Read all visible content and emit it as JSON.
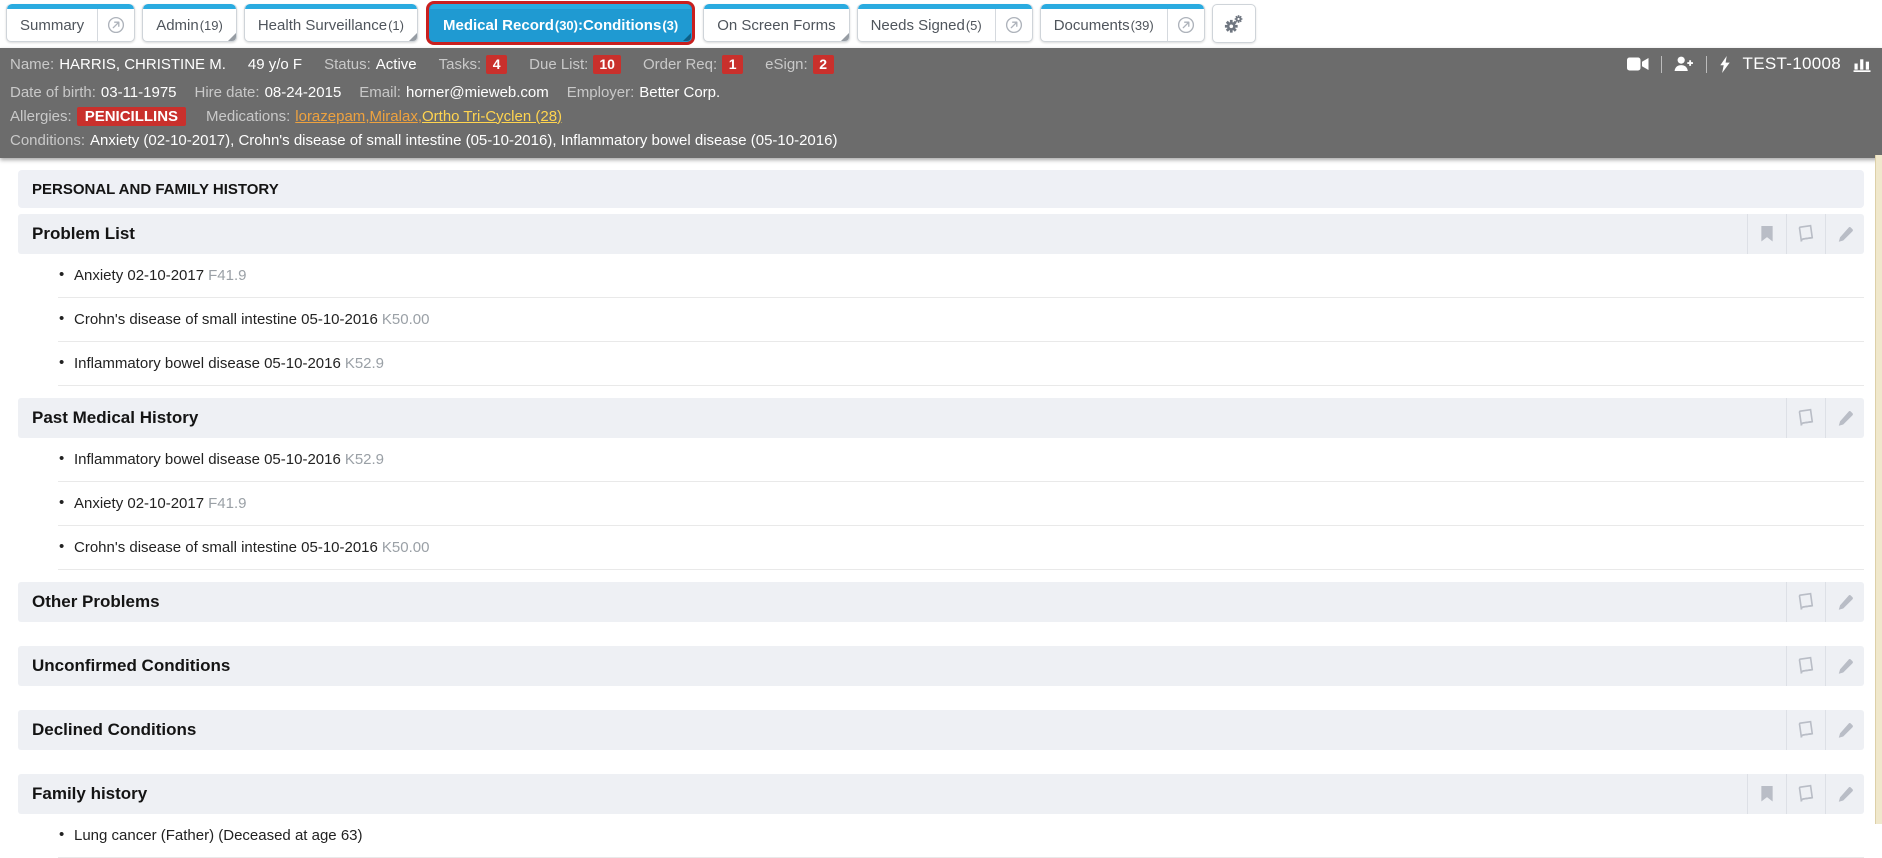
{
  "colors": {
    "tab_blue": "#1f9ad2",
    "tab_cap_blue": "#2aabe0",
    "active_tab_outline_red": "#c9201f",
    "header_bg_gray": "#6c6c6c",
    "badge_red": "#c9302c",
    "band_bg": "#eef0f4",
    "icon_gray": "#b9bdc6",
    "medication_orange": "#eea23f",
    "medication_yellow": "#ffd44f",
    "edge_strip_beige": "#f0e8cc"
  },
  "tab_bar": {
    "tabs": [
      {
        "name": "summary",
        "segments": [
          {
            "text": "Summary",
            "small": false
          }
        ],
        "popout": true,
        "fold": false,
        "active": false
      },
      {
        "name": "admin",
        "segments": [
          {
            "text": "Admin ",
            "small": false
          },
          {
            "text": "(19)",
            "small": true
          }
        ],
        "popout": false,
        "fold": true,
        "active": false
      },
      {
        "name": "health-surveillance",
        "segments": [
          {
            "text": "Health Surveillance ",
            "small": false
          },
          {
            "text": "(1)",
            "small": true
          }
        ],
        "popout": false,
        "fold": true,
        "active": false
      },
      {
        "name": "medical-record",
        "segments": [
          {
            "text": "Medical Record ",
            "small": false
          },
          {
            "text": "(30)",
            "small": true
          },
          {
            "text": ":Conditions ",
            "small": false
          },
          {
            "text": "(3)",
            "small": true
          }
        ],
        "popout": false,
        "fold": true,
        "active": true
      },
      {
        "name": "on-screen-forms",
        "segments": [
          {
            "text": "On Screen Forms",
            "small": false
          }
        ],
        "popout": false,
        "fold": true,
        "active": false
      },
      {
        "name": "needs-signed",
        "segments": [
          {
            "text": "Needs Signed ",
            "small": false
          },
          {
            "text": "(5)",
            "small": true
          }
        ],
        "popout": true,
        "fold": false,
        "active": false
      },
      {
        "name": "documents",
        "segments": [
          {
            "text": "Documents ",
            "small": false
          },
          {
            "text": "(39)",
            "small": true
          }
        ],
        "popout": true,
        "fold": false,
        "active": false
      }
    ]
  },
  "patient_header": {
    "row1": {
      "fields": [
        {
          "label": "Name:",
          "value": "HARRIS, CHRISTINE M."
        },
        {
          "label": "",
          "value": "49 y/o F"
        },
        {
          "label": "Status:",
          "value": "Active"
        },
        {
          "label": "Tasks:",
          "badge": "4"
        },
        {
          "label": "Due List:",
          "badge": "10"
        },
        {
          "label": "Order Req:",
          "badge": "1"
        },
        {
          "label": "eSign:",
          "badge": "2"
        }
      ],
      "station_id": "TEST-10008"
    },
    "row2": {
      "fields": [
        {
          "label": "Date of birth:",
          "value": "03-11-1975"
        },
        {
          "label": "Hire date:",
          "value": "08-24-2015"
        },
        {
          "label": "Email:",
          "value": "horner@mieweb.com"
        },
        {
          "label": "Employer:",
          "value": "Better Corp."
        }
      ]
    },
    "row3": {
      "allergies_label": "Allergies:",
      "allergy_badge": "PENICILLINS",
      "medications_label": "Medications:",
      "separator": ", ",
      "medications": [
        {
          "name": "lorazepam",
          "tone": "orange"
        },
        {
          "name": "Miralax",
          "tone": "orange"
        },
        {
          "name": "Ortho Tri-Cyclen (28)",
          "tone": "yellow"
        }
      ]
    },
    "row4": {
      "label": "Conditions:",
      "value": "Anxiety (02-10-2017), Crohn's disease of small intestine (05-10-2016), Inflammatory bowel disease (05-10-2016)"
    }
  },
  "main": {
    "page_title": "PERSONAL AND FAMILY HISTORY",
    "sections": [
      {
        "title": "Problem List",
        "icons": [
          "bookmark",
          "book",
          "pencil"
        ],
        "items": [
          {
            "text": "Anxiety 02-10-2017",
            "code": "F41.9"
          },
          {
            "text": "Crohn's disease of small intestine 05-10-2016",
            "code": "K50.00"
          },
          {
            "text": "Inflammatory bowel disease 05-10-2016",
            "code": "K52.9"
          }
        ]
      },
      {
        "title": "Past Medical History",
        "icons": [
          "book",
          "pencil"
        ],
        "items": [
          {
            "text": "Inflammatory bowel disease 05-10-2016",
            "code": "K52.9"
          },
          {
            "text": "Anxiety 02-10-2017",
            "code": "F41.9"
          },
          {
            "text": "Crohn's disease of small intestine 05-10-2016",
            "code": "K50.00"
          }
        ]
      },
      {
        "title": "Other Problems",
        "icons": [
          "book",
          "pencil"
        ],
        "items": []
      },
      {
        "title": "Unconfirmed Conditions",
        "icons": [
          "book",
          "pencil"
        ],
        "items": []
      },
      {
        "title": "Declined Conditions",
        "icons": [
          "book",
          "pencil"
        ],
        "items": []
      },
      {
        "title": "Family history",
        "icons": [
          "bookmark",
          "book",
          "pencil"
        ],
        "items": [
          {
            "text": "Lung cancer (Father) (Deceased at age 63)",
            "code": ""
          }
        ]
      }
    ]
  }
}
